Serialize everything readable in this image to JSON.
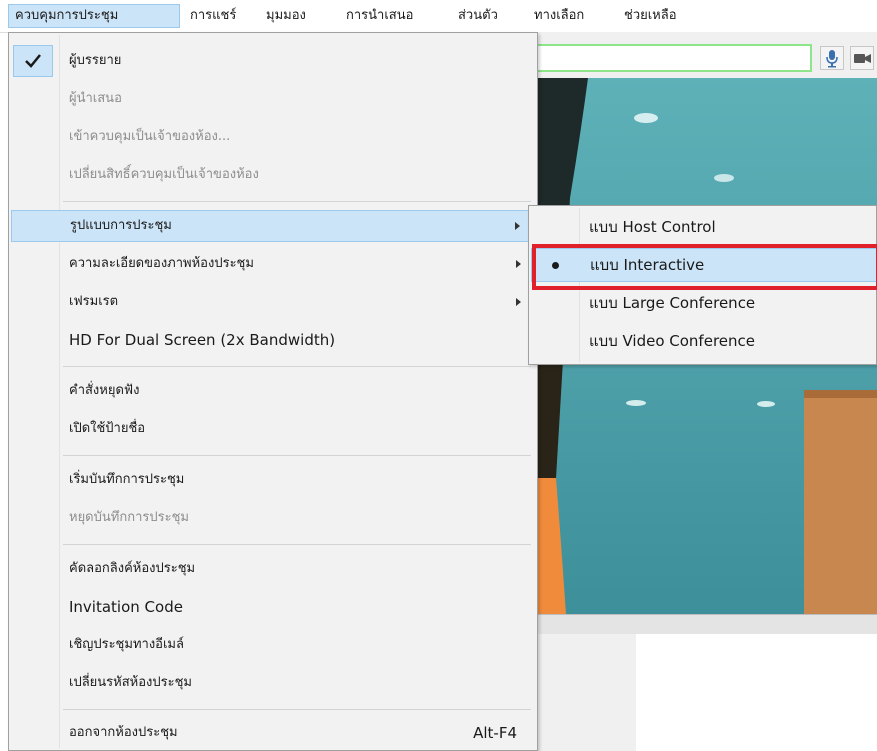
{
  "menubar": {
    "items": [
      "ควบคุมการประชุม",
      "การแชร์",
      "มุมมอง",
      "การนำเสนอ",
      "ส่วนตัว",
      "ทางเลือก",
      "ช่วยเหลือ"
    ]
  },
  "main_menu": {
    "items": [
      {
        "label": "ผู้บรรยาย",
        "checked": true
      },
      {
        "label": "ผู้นำเสนอ",
        "disabled": true
      },
      {
        "label": "เข้าควบคุมเป็นเจ้าของห้อง...",
        "disabled": true
      },
      {
        "label": "เปลี่ยนสิทธิ์ควบคุมเป็นเจ้าของห้อง",
        "disabled": true
      },
      {
        "label": "รูปแบบการประชุม",
        "submenu": true,
        "highlighted": true
      },
      {
        "label": "ความละเอียดของภาพห้องประชุม",
        "submenu": true
      },
      {
        "label": "เฟรมเรต",
        "submenu": true
      },
      {
        "label": "HD For Dual Screen (2x Bandwidth)"
      },
      {
        "label": "คำสั่งหยุดฟัง"
      },
      {
        "label": "เปิดใช้ป้ายชื่อ"
      },
      {
        "label": "เริ่มบันทึกการประชุม"
      },
      {
        "label": "หยุดบันทึกการประชุม",
        "disabled": true
      },
      {
        "label": "คัดลอกลิงค์ห้องประชุม"
      },
      {
        "label": "Invitation Code"
      },
      {
        "label": "เชิญประชุมทางอีเมล์"
      },
      {
        "label": "เปลี่ยนรหัสห้องประชุม"
      },
      {
        "label": "ออกจากห้องประชุม",
        "shortcut": "Alt-F4"
      }
    ]
  },
  "submenu": {
    "items": [
      {
        "label": "แบบ Host Control"
      },
      {
        "label": "แบบ Interactive",
        "selected": true
      },
      {
        "label": "แบบ Large Conference"
      },
      {
        "label": "แบบ Video Conference"
      }
    ]
  },
  "icons": {
    "check": "check-icon",
    "radio": "radio-dot-icon",
    "submenu_arrow": "chevron-right-icon",
    "microphone": "microphone-icon",
    "camera": "camera-icon"
  },
  "colors": {
    "highlight": "#cce4f7",
    "highlight_border": "#99c9ef",
    "annotation_red": "#e0202a",
    "input_border": "#8fe58a"
  }
}
